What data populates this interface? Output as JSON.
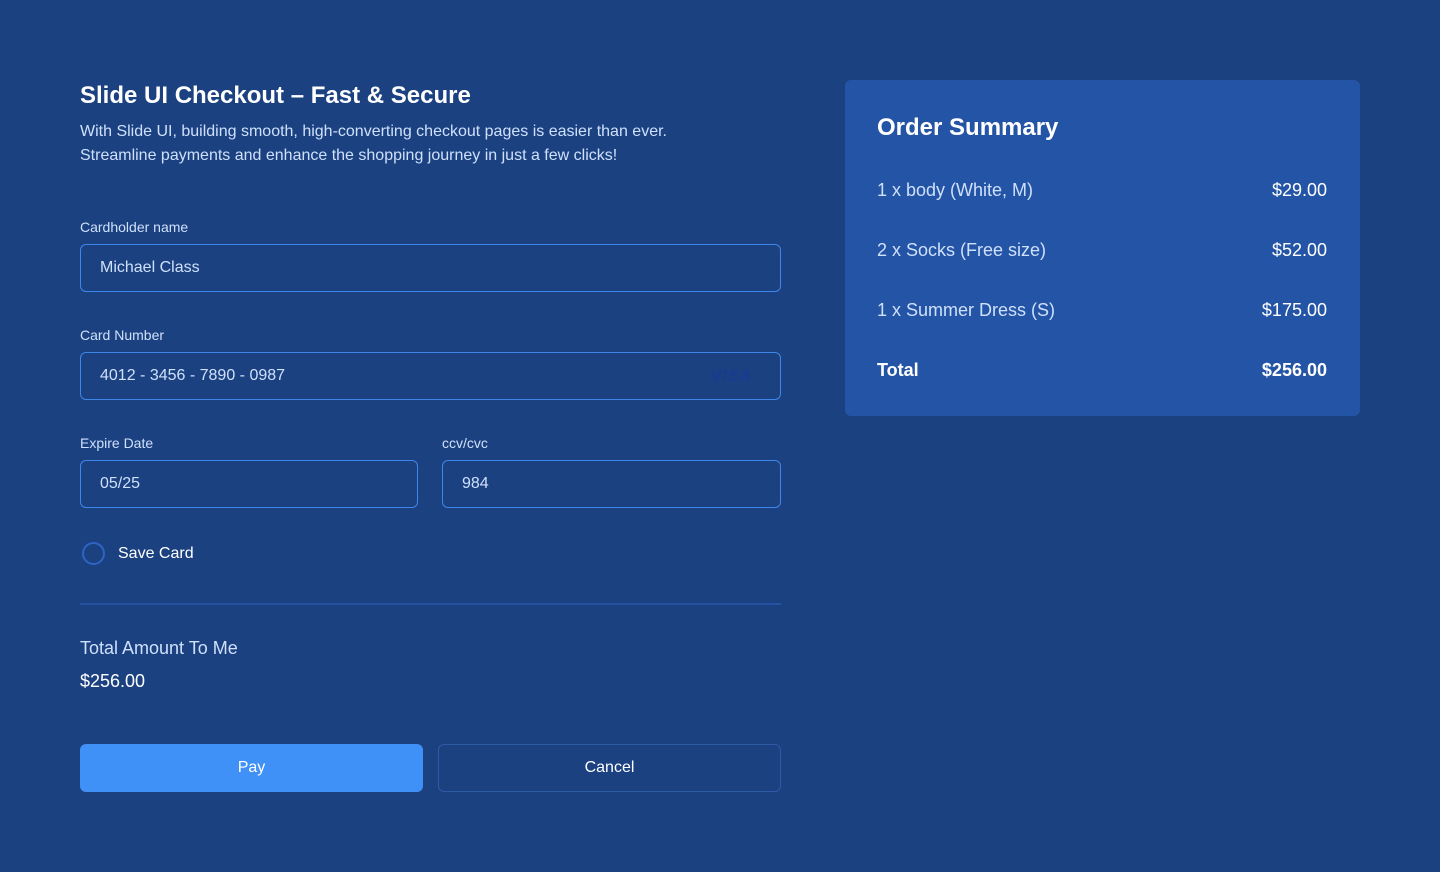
{
  "checkout": {
    "title": "Slide UI Checkout – Fast & Secure",
    "subtitle_line1": "With Slide UI, building smooth, high-converting checkout pages is easier than ever.",
    "subtitle_line2": "Streamline payments and enhance the shopping journey in just a few clicks!",
    "cardholder": {
      "label": "Cardholder name",
      "value": "Michael Class"
    },
    "card_number": {
      "label": "Card Number",
      "value": "4012 - 3456 - 7890 - 0987",
      "brand": "VISA",
      "brand_icon": "visa-icon"
    },
    "expire": {
      "label": "Expire Date",
      "value": "05/25"
    },
    "cvc": {
      "label": "ccv/cvc",
      "value": "984"
    },
    "save_card": {
      "label": "Save Card",
      "checked": false
    },
    "total_label": "Total Amount To Me",
    "total_value": "$256.00",
    "pay_label": "Pay",
    "cancel_label": "Cancel"
  },
  "summary": {
    "title": "Order Summary",
    "items": [
      {
        "name": "1 x body (White, M)",
        "price": "$29.00"
      },
      {
        "name": "2 x Socks (Free size)",
        "price": "$52.00"
      },
      {
        "name": "1 x Summer Dress (S)",
        "price": "$175.00"
      }
    ],
    "total_label": "Total",
    "total_value": "$256.00"
  },
  "colors": {
    "background": "#1b4181",
    "panel": "#2454a6",
    "accent": "#3f90f7",
    "input_border": "#3f86ea"
  }
}
